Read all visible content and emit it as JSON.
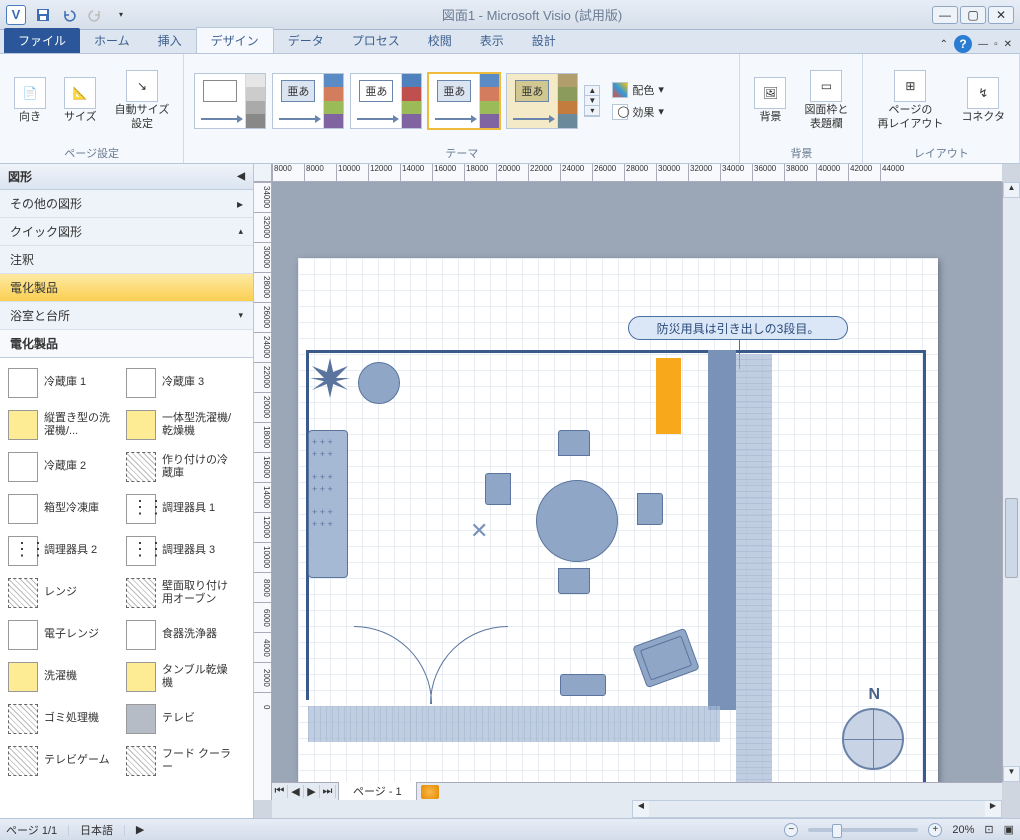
{
  "title": "図面1 - Microsoft Visio (試用版)",
  "ribbon_tabs": [
    "ファイル",
    "ホーム",
    "挿入",
    "デザイン",
    "データ",
    "プロセス",
    "校閲",
    "表示",
    "設計"
  ],
  "active_tab_index": 3,
  "ribbon": {
    "page_setup_label": "ページ設定",
    "orientation": "向き",
    "size": "サイズ",
    "autosize": "自動サイズ\n設定",
    "theme_label": "テーマ",
    "theme_sample": "亜あ",
    "colors": "配色",
    "effects": "効果",
    "bg_group": "背景",
    "bg_btn": "背景",
    "border_title": "図面枠と\n表題欄",
    "layout_group": "レイアウト",
    "relayout": "ページの\n再レイアウト",
    "connectors": "コネクタ"
  },
  "shapes": {
    "header": "図形",
    "stencils": [
      "その他の図形",
      "クイック図形",
      "注釈",
      "電化製品",
      "浴室と台所"
    ],
    "active_stencil_index": 3,
    "grid_header": "電化製品",
    "items": [
      [
        "冷蔵庫 1",
        "冷蔵庫 3"
      ],
      [
        "縦置き型の洗濯機/...",
        "一体型洗濯機/乾燥機"
      ],
      [
        "冷蔵庫 2",
        "作り付けの冷蔵庫"
      ],
      [
        "箱型冷凍庫",
        "調理器具 1"
      ],
      [
        "調理器具 2",
        "調理器具 3"
      ],
      [
        "レンジ",
        "壁面取り付け用オーブン"
      ],
      [
        "電子レンジ",
        "食器洗浄器"
      ],
      [
        "洗濯機",
        "タンブル乾燥機"
      ],
      [
        "ゴミ処理機",
        "テレビ"
      ],
      [
        "テレビゲーム",
        "フード クーラー"
      ]
    ],
    "icon_styles": [
      [
        "",
        ""
      ],
      [
        "yellow",
        "yellow"
      ],
      [
        "",
        "hatch"
      ],
      [
        "",
        "dots"
      ],
      [
        "dots",
        "dots"
      ],
      [
        "hatch",
        "hatch"
      ],
      [
        "",
        ""
      ],
      [
        "yellow",
        "yellow"
      ],
      [
        "hatch",
        "gray"
      ],
      [
        "hatch",
        "hatch"
      ]
    ]
  },
  "ruler_h": [
    "8000",
    "8000",
    "10000",
    "12000",
    "14000",
    "16000",
    "18000",
    "20000",
    "22000",
    "24000",
    "26000",
    "28000",
    "30000",
    "32000",
    "34000",
    "36000",
    "38000",
    "40000",
    "42000",
    "44000"
  ],
  "ruler_v": [
    "34000",
    "32000",
    "30000",
    "28000",
    "26000",
    "24000",
    "22000",
    "20000",
    "18000",
    "16000",
    "14000",
    "12000",
    "10000",
    "8000",
    "6000",
    "4000",
    "2000",
    "0"
  ],
  "canvas": {
    "callout_text": "防災用具は引き出しの3段目。",
    "compass_n": "N"
  },
  "page_tabs": {
    "page1": "ページ - 1"
  },
  "status": {
    "page": "ページ 1/1",
    "lang": "日本語",
    "zoom": "20%"
  }
}
